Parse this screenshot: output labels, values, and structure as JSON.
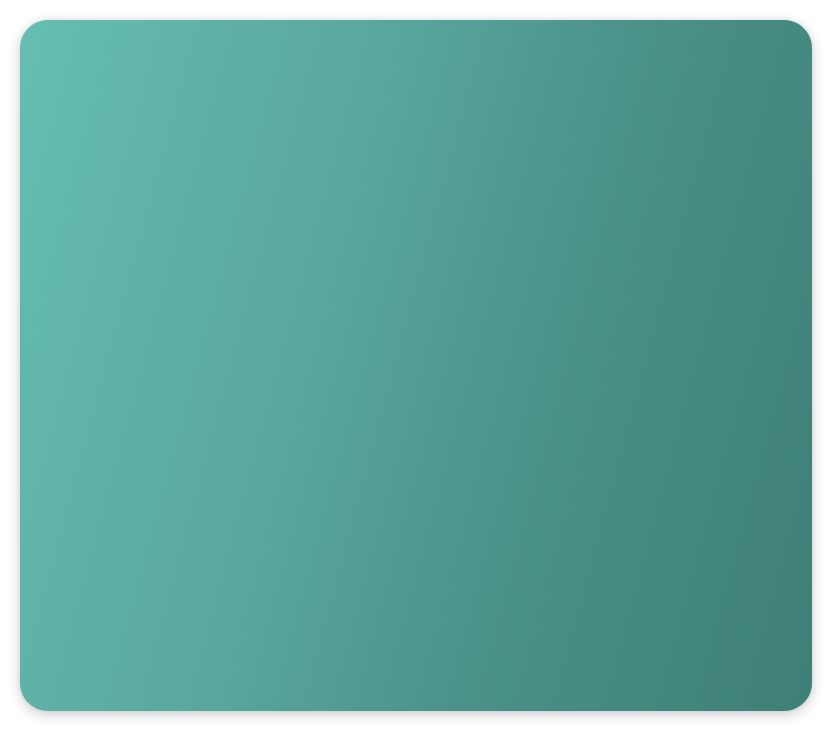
{
  "card": {
    "gradient_start": "#66bdb2",
    "gradient_end": "#3e7f76"
  }
}
